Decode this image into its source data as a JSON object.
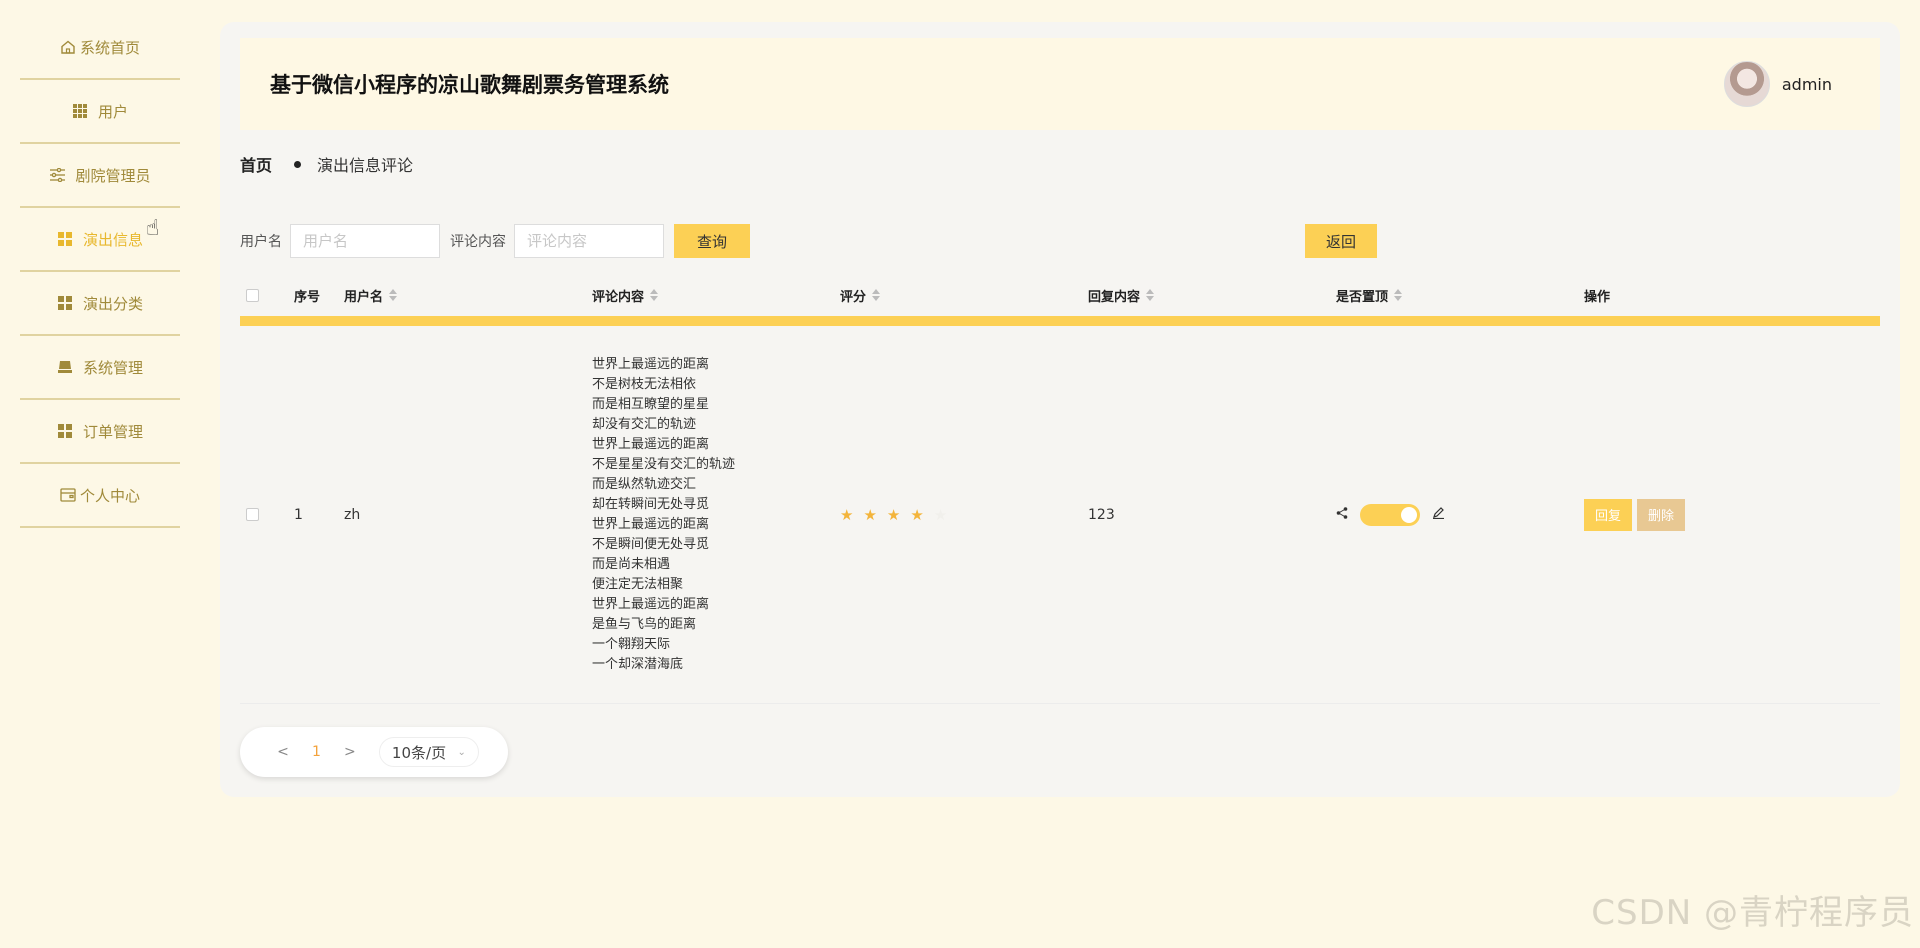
{
  "sidebar": {
    "items": [
      {
        "label": "系统首页",
        "icon": "home-icon"
      },
      {
        "label": "用户",
        "icon": "grid-icon"
      },
      {
        "label": "剧院管理员",
        "icon": "sliders-icon"
      },
      {
        "label": "演出信息",
        "icon": "grid4-icon",
        "active": true
      },
      {
        "label": "演出分类",
        "icon": "grid4-icon"
      },
      {
        "label": "系统管理",
        "icon": "box-icon"
      },
      {
        "label": "订单管理",
        "icon": "grid4-icon"
      },
      {
        "label": "个人中心",
        "icon": "wallet-icon"
      }
    ]
  },
  "header": {
    "title": "基于微信小程序的凉山歌舞剧票务管理系统",
    "username": "admin"
  },
  "breadcrumb": {
    "home": "首页",
    "current": "演出信息评论"
  },
  "search": {
    "username_label": "用户名",
    "username_placeholder": "用户名",
    "comment_label": "评论内容",
    "comment_placeholder": "评论内容",
    "query_button": "查询",
    "back_button": "返回"
  },
  "table": {
    "columns": {
      "no": "序号",
      "username": "用户名",
      "comment": "评论内容",
      "score": "评分",
      "reply": "回复内容",
      "pinned": "是否置顶",
      "ops": "操作"
    },
    "rows": [
      {
        "no": "1",
        "username": "zh",
        "comment_lines": [
          "世界上最遥远的距离",
          "不是树枝无法相依",
          "而是相互瞭望的星星",
          "却没有交汇的轨迹",
          "世界上最遥远的距离",
          "不是星星没有交汇的轨迹",
          "而是纵然轨迹交汇",
          "却在转瞬间无处寻觅",
          "世界上最遥远的距离",
          "不是瞬间便无处寻觅",
          "而是尚未相遇",
          "便注定无法相聚",
          "世界上最遥远的距离",
          "是鱼与飞鸟的距离",
          "一个翱翔天际",
          "一个却深潜海底"
        ],
        "stars": 4,
        "reply": "123",
        "pinned": true,
        "reply_button": "回复",
        "delete_button": "删除"
      }
    ]
  },
  "pagination": {
    "prev": "<",
    "current": "1",
    "next": ">",
    "page_size": "10条/页"
  },
  "watermark": "CSDN @青柠程序员",
  "colors": {
    "accent": "#fcd055",
    "background": "#fdf8e6",
    "sidebar_text": "#a08a3a",
    "active_text": "#e8b82e"
  }
}
